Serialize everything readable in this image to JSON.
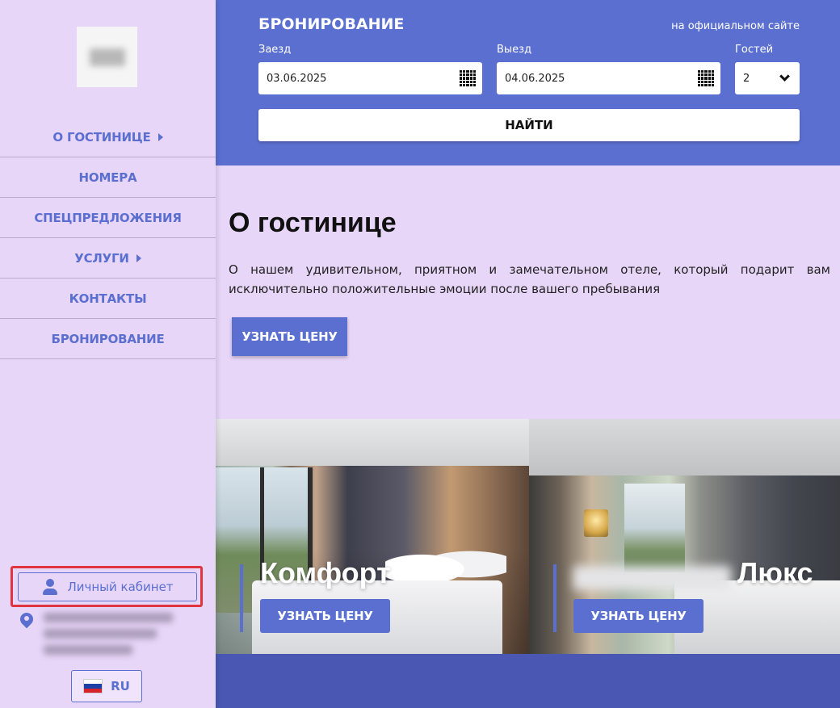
{
  "sidebar": {
    "nav": [
      {
        "label": "О ГОСТИНИЦЕ",
        "has_submenu": true
      },
      {
        "label": "НОМЕРА",
        "has_submenu": false
      },
      {
        "label": "СПЕЦПРЕДЛОЖЕНИЯ",
        "has_submenu": false
      },
      {
        "label": "УСЛУГИ",
        "has_submenu": true
      },
      {
        "label": "КОНТАКТЫ",
        "has_submenu": false
      },
      {
        "label": "БРОНИРОВАНИЕ",
        "has_submenu": false
      }
    ],
    "cabinet_label": "Личный кабинет",
    "language": "RU"
  },
  "booking": {
    "title": "БРОНИРОВАНИЕ",
    "official_link": "на официальном сайте",
    "checkin_label": "Заезд",
    "checkin_value": "03.06.2025",
    "checkout_label": "Выезд",
    "checkout_value": "04.06.2025",
    "guests_label": "Гостей",
    "guests_value": "2",
    "search_label": "НАЙТИ"
  },
  "about": {
    "title": "О гостинице",
    "text": "О нашем удивительном, приятном и замечательном отеле, который подарит вам исключительно положительные эмоции после вашего пребывания",
    "price_button": "УЗНАТЬ ЦЕНУ"
  },
  "rooms": [
    {
      "title": "Комфорт",
      "button": "УЗНАТЬ ЦЕНУ"
    },
    {
      "title": "Люкс",
      "button": "УЗНАТЬ ЦЕНУ"
    }
  ],
  "colors": {
    "accent": "#5a6fd0",
    "sidebar_bg": "#e8d6f8",
    "highlight": "#e0343f"
  }
}
